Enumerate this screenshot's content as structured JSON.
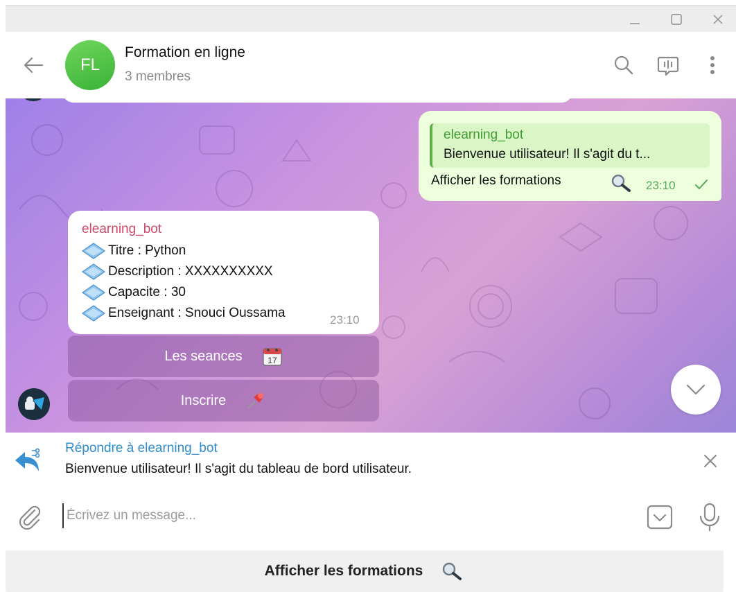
{
  "window": {
    "controls": [
      "minimize-icon",
      "maximize-icon",
      "close-icon"
    ]
  },
  "header": {
    "avatar_initials": "FL",
    "title": "Formation en ligne",
    "subtitle": "3 membres",
    "avatar_color": "#4cbf3e",
    "icons": [
      "back-arrow-icon",
      "search-icon",
      "voice-chat-icon",
      "more-vert-icon"
    ]
  },
  "messages": {
    "outgoing": {
      "quote_name": "elearning_bot",
      "quote_text": "Bienvenue utilisateur! Il s'agit du t...",
      "text": "Afficher les formations",
      "emoji_icon": "magnifier-icon",
      "time": "23:10",
      "status_icon": "check-icon"
    },
    "incoming": {
      "sender": "elearning_bot",
      "lines": [
        "Titre : Python",
        "Description : XXXXXXXXXX",
        "Capacite : 30",
        "Enseignant : Snouci Oussama"
      ],
      "bullet_icon": "diamond-icon",
      "time": "23:10",
      "buttons": [
        {
          "label": "Les seances",
          "icon": "calendar-icon"
        },
        {
          "label": "Inscrire",
          "icon": "pushpin-icon"
        }
      ]
    }
  },
  "reply": {
    "title": "Répondre à elearning_bot",
    "text": "Bienvenue utilisateur! Il s'agit du tableau de bord utilisateur."
  },
  "composer": {
    "placeholder": "Écrivez un message..."
  },
  "keyboard": {
    "button_label": "Afficher les formations",
    "button_icon": "magnifier-icon"
  },
  "colors": {
    "outgoing_bubble": "#eeffde",
    "sender_name": "#d04868",
    "quote_name": "#3f9b32",
    "reply_title": "#2d8ccb",
    "accent_blue": "#3a8fd0"
  }
}
